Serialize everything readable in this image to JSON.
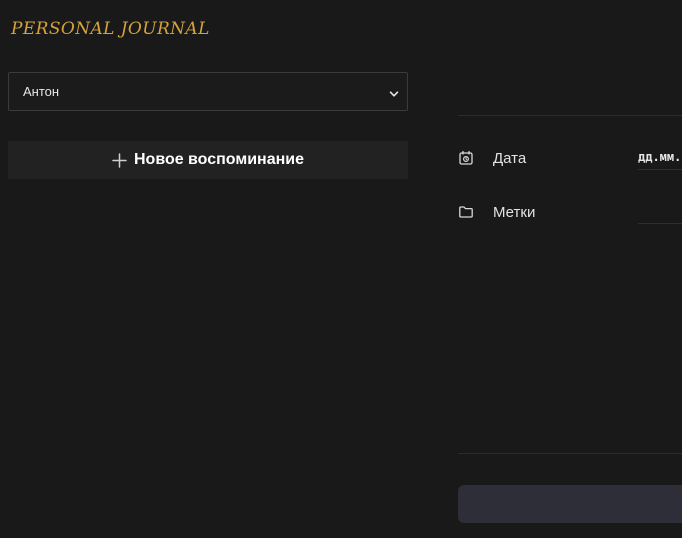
{
  "app": {
    "logo_text": "PERSONAL JOURNAL",
    "accent_color": "#d4a33a"
  },
  "user_select": {
    "selected": "Антон",
    "icon": "chevron-down-icon"
  },
  "new_memory_button": {
    "label": "Новое воспоминание",
    "icon": "plus-icon"
  },
  "meta": {
    "date": {
      "label": "Дата",
      "placeholder": "дд.мм.гггг",
      "icon": "calendar-icon"
    },
    "tags": {
      "label": "Метки",
      "value": "",
      "icon": "folder-icon"
    }
  }
}
